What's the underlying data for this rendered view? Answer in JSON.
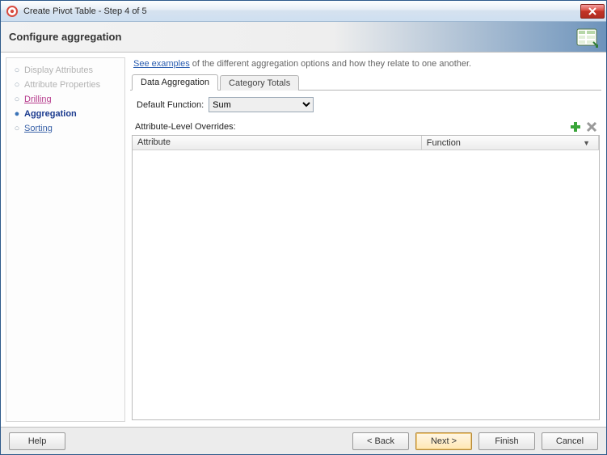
{
  "window": {
    "title": "Create Pivot Table - Step 4 of 5"
  },
  "header": {
    "heading": "Configure aggregation"
  },
  "sidebar": {
    "steps": [
      {
        "label": "Display Attributes",
        "state": "disabled"
      },
      {
        "label": "Attribute Properties",
        "state": "disabled"
      },
      {
        "label": "Drilling",
        "state": "magenta"
      },
      {
        "label": "Aggregation",
        "state": "current"
      },
      {
        "label": "Sorting",
        "state": "link"
      }
    ]
  },
  "examples": {
    "link_text": "See examples",
    "rest": " of the different aggregation options and how they relate to one another."
  },
  "tabs": [
    {
      "label": "Data Aggregation",
      "active": true
    },
    {
      "label": "Category Totals",
      "active": false
    }
  ],
  "default_function": {
    "label": "Default Function:",
    "value": "Sum",
    "options": [
      "Sum"
    ]
  },
  "overrides": {
    "section_label": "Attribute-Level Overrides:",
    "columns": {
      "attribute": "Attribute",
      "function": "Function"
    },
    "rows": []
  },
  "buttons": {
    "help": "Help",
    "back": "< Back",
    "next": "Next >",
    "finish": "Finish",
    "cancel": "Cancel"
  }
}
